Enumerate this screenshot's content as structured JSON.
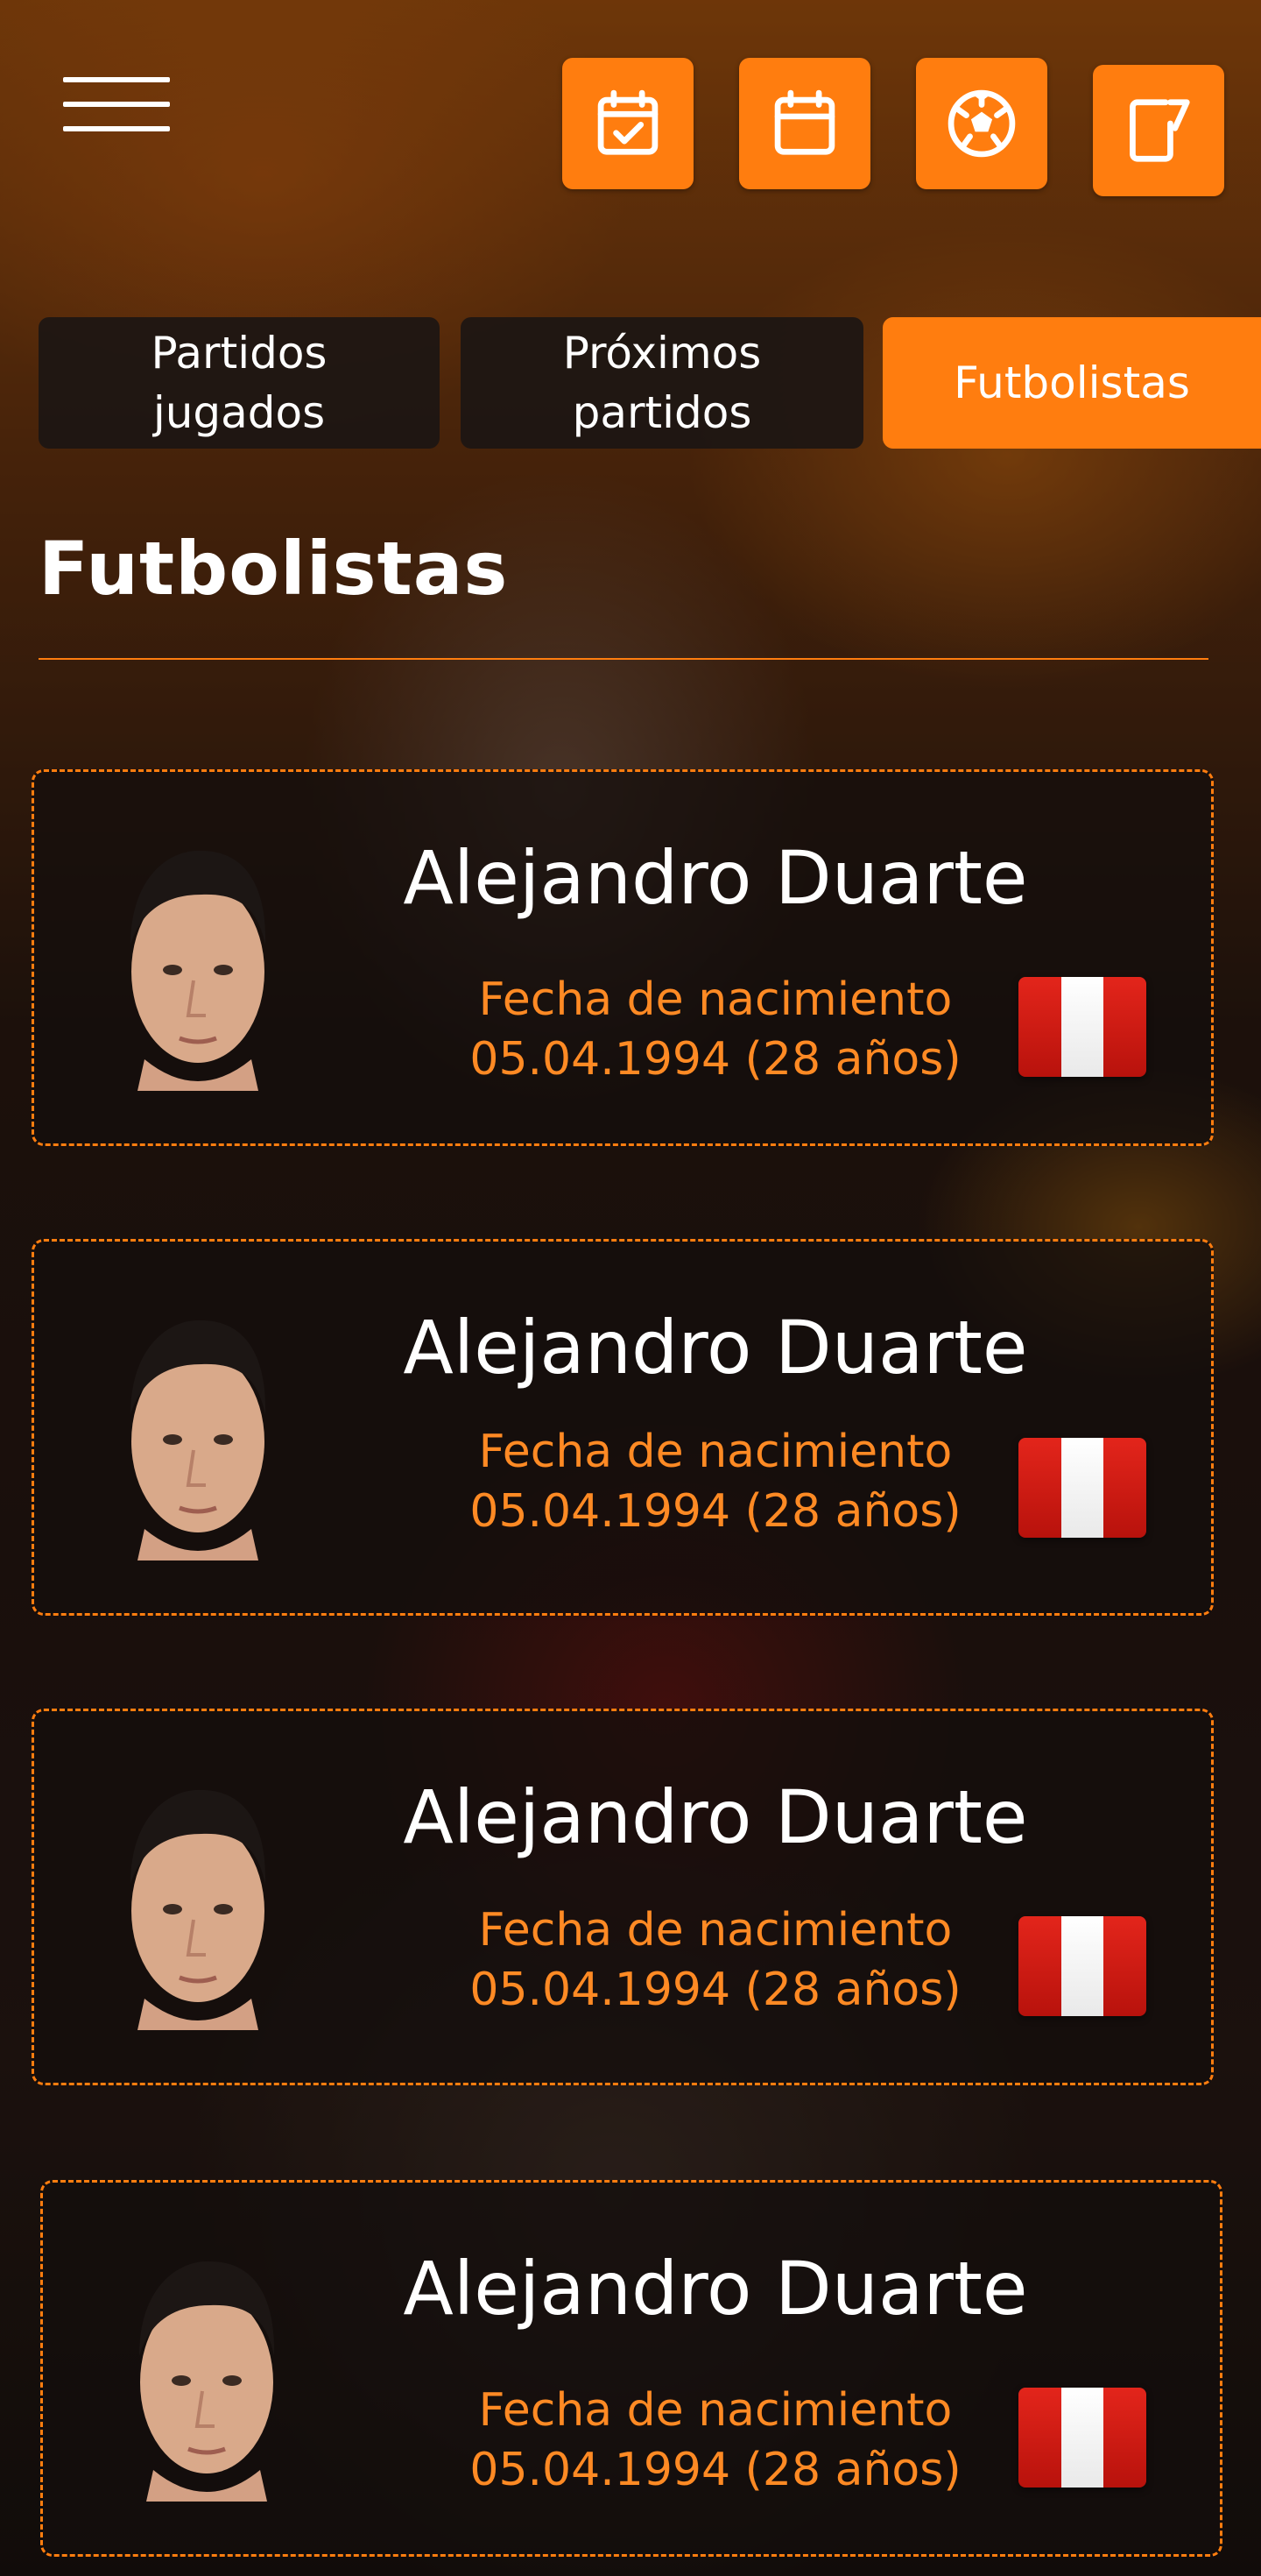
{
  "header": {
    "menu_icon": "hamburger-menu-icon",
    "actions": [
      {
        "icon": "calendar-check-icon"
      },
      {
        "icon": "calendar-icon"
      },
      {
        "icon": "soccer-ball-icon"
      },
      {
        "icon": "edit-note-icon"
      }
    ]
  },
  "tabs": [
    {
      "label": "Partidos\njugados",
      "active": false
    },
    {
      "label": "Próximos\npartidos",
      "active": false
    },
    {
      "label": "Futbolistas",
      "active": true
    }
  ],
  "section": {
    "title": "Futbolistas"
  },
  "players": [
    {
      "name": "Alejandro Duarte",
      "dob_label": "Fecha de nacimiento",
      "dob_value": "05.04.1994 (28 años)",
      "flag": "peru-flag"
    },
    {
      "name": "Alejandro Duarte",
      "dob_label": "Fecha de nacimiento",
      "dob_value": "05.04.1994 (28 años)",
      "flag": "peru-flag"
    },
    {
      "name": "Alejandro Duarte",
      "dob_label": "Fecha de nacimiento",
      "dob_value": "05.04.1994 (28 años)",
      "flag": "peru-flag"
    },
    {
      "name": "Alejandro Duarte",
      "dob_label": "Fecha de nacimiento",
      "dob_value": "05.04.1994 (28 años)",
      "flag": "peru-flag"
    }
  ],
  "colors": {
    "accent": "#ff7d0f",
    "accent_text": "#ff8a24",
    "card_background": "#140e0c",
    "flag_red": "#d91f16",
    "flag_white": "#ffffff"
  }
}
